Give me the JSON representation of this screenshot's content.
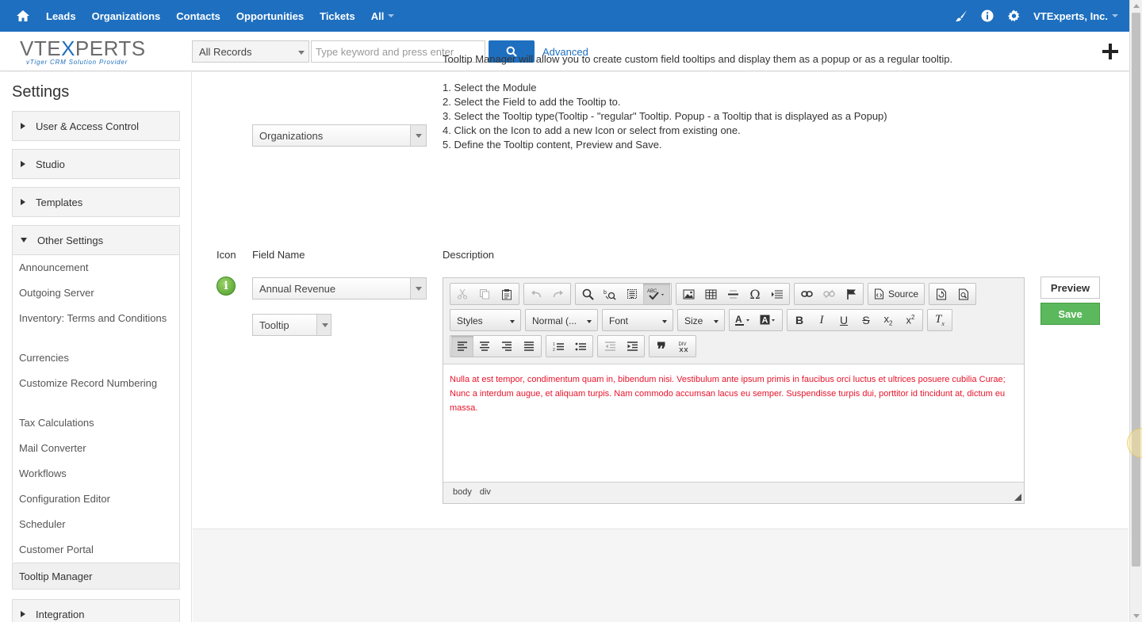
{
  "topnav": {
    "items": [
      "Leads",
      "Organizations",
      "Contacts",
      "Opportunities",
      "Tickets",
      "All"
    ],
    "user": "VTExperts, Inc."
  },
  "header": {
    "logo_main": "VTEXPERTS",
    "logo_tagline": "vTiger CRM Solution Provider",
    "records_select": "All Records",
    "search_placeholder": "Type keyword and press enter",
    "advanced": "Advanced"
  },
  "sidebar": {
    "title": "Settings",
    "sections": [
      "User & Access Control",
      "Studio",
      "Templates",
      "Other Settings"
    ],
    "other_items": [
      "Announcement",
      "Outgoing Server",
      "Inventory: Terms and Conditions",
      "Currencies",
      "Customize Record Numbering",
      "Tax Calculations",
      "Mail Converter",
      "Workflows",
      "Configuration Editor",
      "Scheduler",
      "Customer Portal"
    ],
    "active_item": "Tooltip Manager",
    "integration": "Integration"
  },
  "main": {
    "module_select": "Organizations",
    "intro": "Tooltip Manager will allow you to create custom field tooltips and display them as a popup or as a regular tooltip.",
    "steps": [
      "1. Select the Module",
      "2. Select the Field to add the Tooltip to.",
      "3. Select the Tooltip type(Tooltip - \"regular\" Tooltip. Popup - a Tooltip that is displayed as a Popup)",
      "4. Click on the Icon to add a new Icon or select from existing one.",
      "5. Define the Tooltip content, Preview and Save."
    ],
    "col_icon": "Icon",
    "col_field": "Field Name",
    "col_desc": "Description",
    "info_glyph": "i",
    "field_select": "Annual Revenue",
    "type_select": "Tooltip",
    "preview": "Preview",
    "save": "Save"
  },
  "editor": {
    "source_label": "Source",
    "combos": [
      "Styles",
      "Normal (...",
      "Font",
      "Size"
    ],
    "content": "Nulla at est tempor, condimentum quam in, bibendum nisi. Vestibulum ante ipsum primis in faucibus orci luctus et ultrices posuere cubilia Curae; Nunc a interdum augue, et aliquam turpis. Nam commodo accumsan lacus eu semper. Suspendisse turpis dui, porttitor id tincidunt at, dictum eu massa.",
    "path": [
      "body",
      "div"
    ],
    "text_color": "#e8132a"
  },
  "colors": {
    "nav_bg": "#1e6fbf",
    "save_bg": "#5cb85c"
  }
}
